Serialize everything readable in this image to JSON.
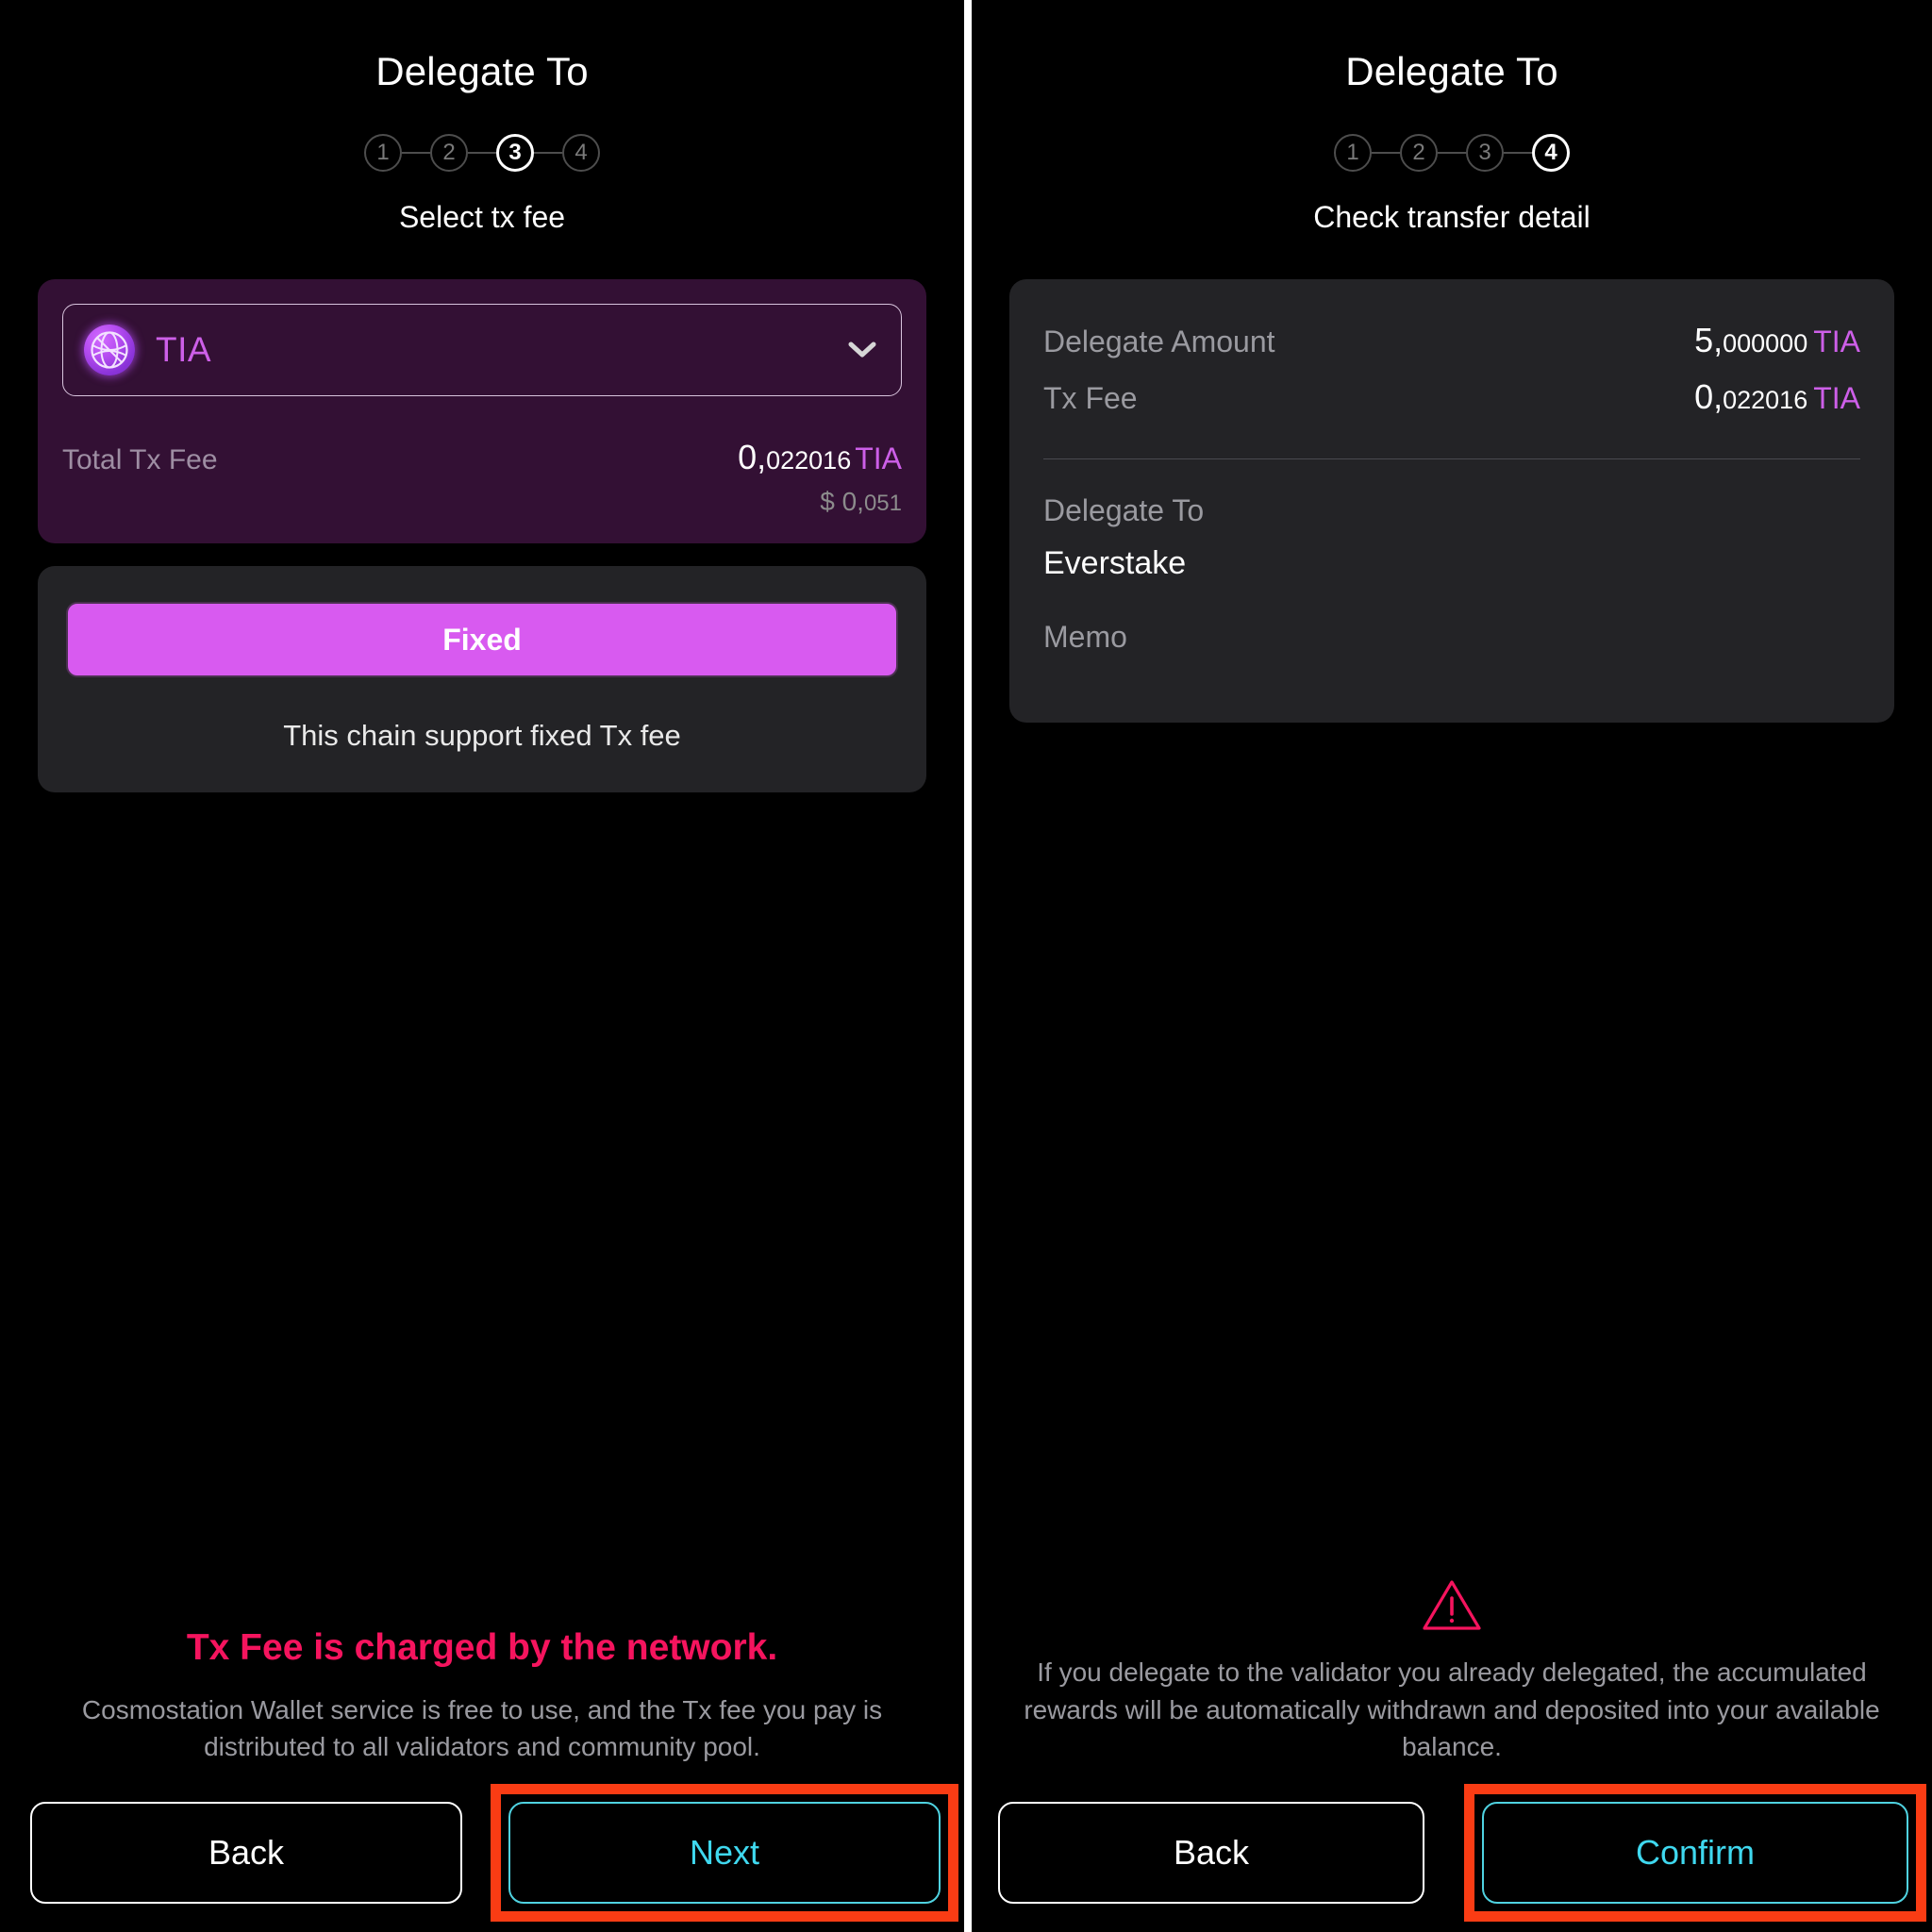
{
  "left_panel": {
    "title": "Delegate To",
    "stepper": {
      "steps": [
        "1",
        "2",
        "3",
        "4"
      ],
      "active": "3"
    },
    "subtitle": "Select tx fee",
    "fee_card": {
      "token_symbol": "TIA",
      "token_logo_name": "celestia-tia-logo",
      "total_label": "Total Tx Fee",
      "total_int": "0,",
      "total_frac": "022016",
      "total_unit": "TIA",
      "fiat": "$ 0,051",
      "fiat_int": "$ 0,",
      "fiat_frac": "051"
    },
    "fixed_card": {
      "button_label": "Fixed",
      "note": "This chain support fixed Tx fee"
    },
    "notice": {
      "title": "Tx Fee is charged by the network.",
      "body": "Cosmostation Wallet service is free to use, and the Tx fee you pay is distributed to all validators and community pool."
    },
    "buttons": {
      "back": "Back",
      "primary": "Next"
    }
  },
  "right_panel": {
    "title": "Delegate To",
    "stepper": {
      "steps": [
        "1",
        "2",
        "3",
        "4"
      ],
      "active": "4"
    },
    "subtitle": "Check transfer detail",
    "detail_card": {
      "rows": [
        {
          "label": "Delegate Amount",
          "int": "5,",
          "frac": "000000",
          "unit": "TIA"
        },
        {
          "label": "Tx Fee",
          "int": "0,",
          "frac": "022016",
          "unit": "TIA"
        }
      ],
      "delegate_to_label": "Delegate To",
      "delegate_to_value": "Everstake",
      "memo_label": "Memo",
      "memo_value": ""
    },
    "notice": {
      "body": "If you delegate to the validator you already delegated, the accumulated rewards will be automatically withdrawn and deposited into your available balance."
    },
    "buttons": {
      "back": "Back",
      "primary": "Confirm"
    }
  },
  "colors": {
    "accent_purple": "#cd5fe8",
    "fee_card_bg": "#331034",
    "card_bg": "#232326",
    "primary_button": "#3fd8ef",
    "warning_pink": "#f5145e",
    "highlight_red": "#fa3c14",
    "fixed_button": "#d85af0"
  }
}
